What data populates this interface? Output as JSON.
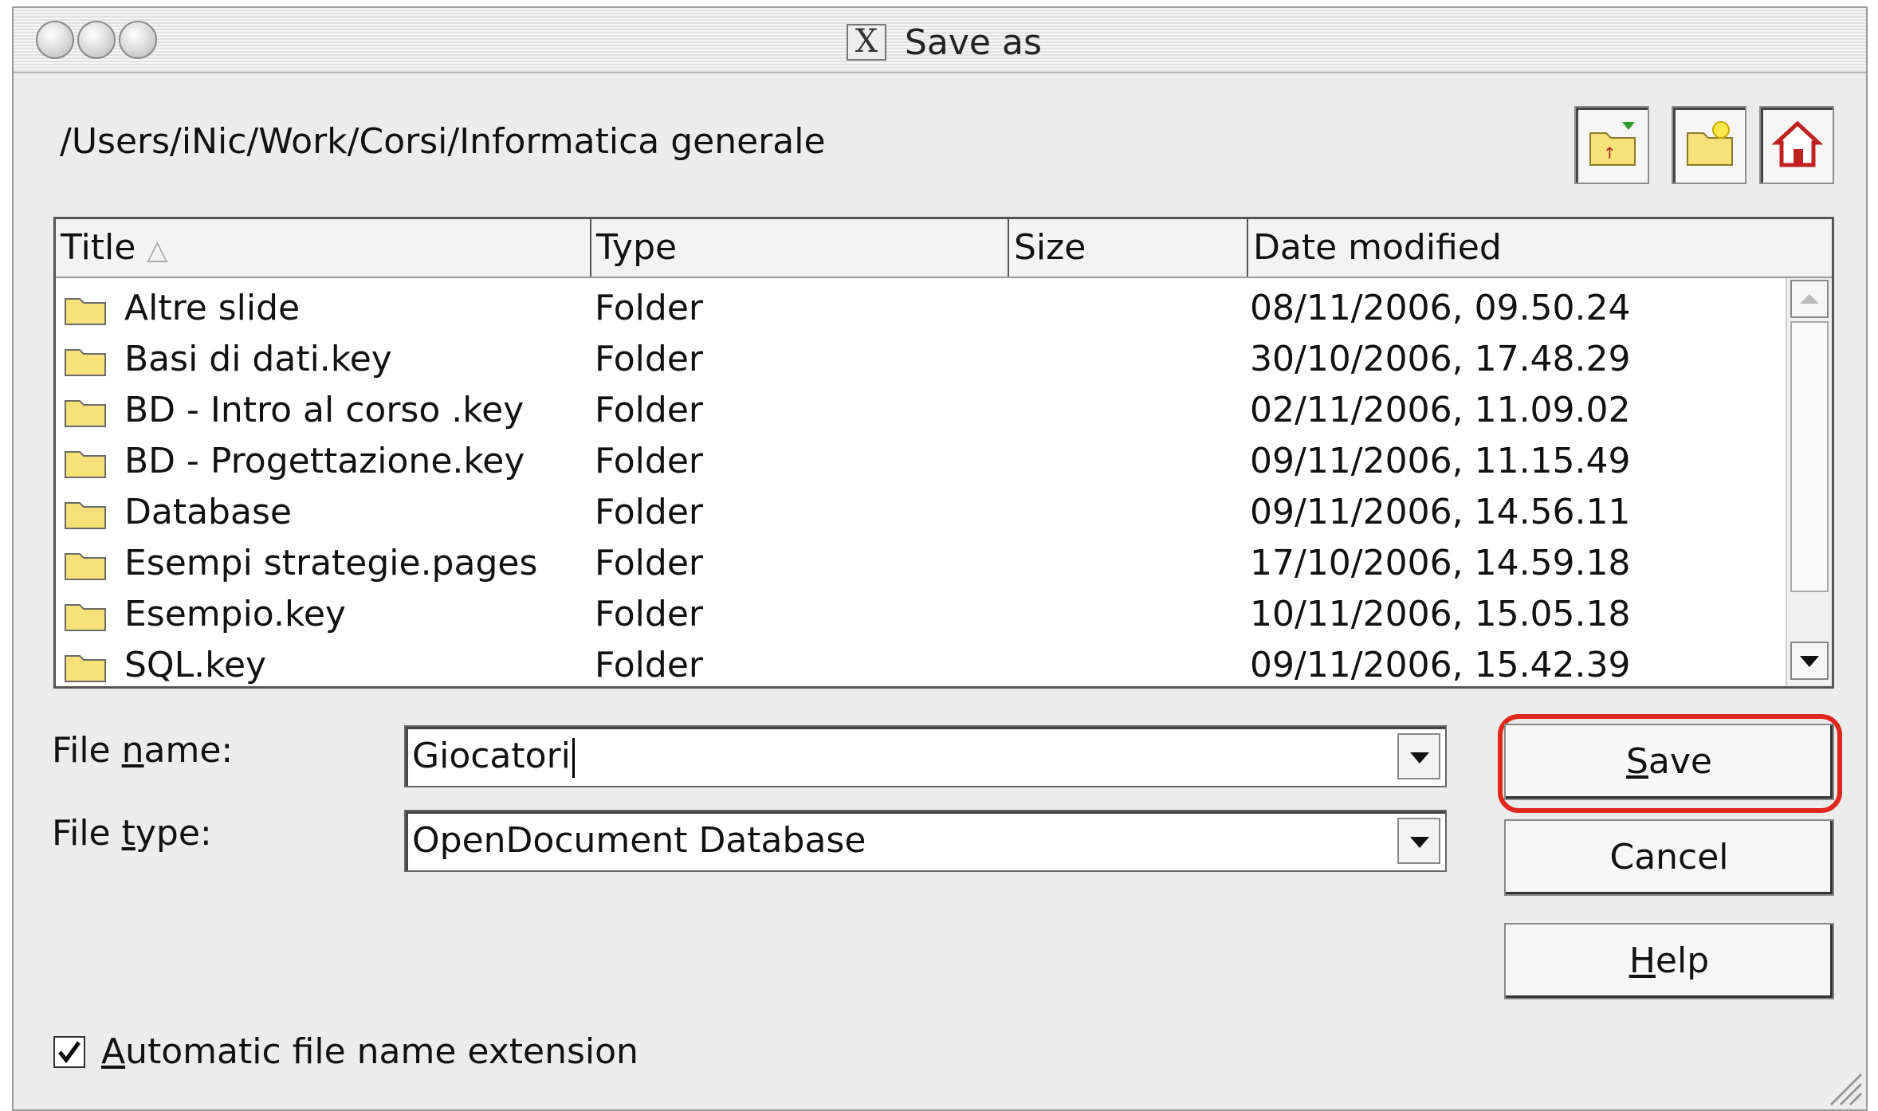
{
  "window": {
    "title": "Save as"
  },
  "path": "/Users/iNic/Work/Corsi/Informatica generale",
  "toolbar": {
    "up_icon": "folder-up-icon",
    "new_folder_icon": "new-folder-icon",
    "home_icon": "home-icon"
  },
  "columns": [
    "Title",
    "Type",
    "Size",
    "Date modified"
  ],
  "files": [
    {
      "name": "Altre slide",
      "type": "Folder",
      "size": "",
      "date": "08/11/2006, 09.50.24"
    },
    {
      "name": "Basi di dati.key",
      "type": "Folder",
      "size": "",
      "date": "30/10/2006, 17.48.29"
    },
    {
      "name": "BD - Intro al corso .key",
      "type": "Folder",
      "size": "",
      "date": "02/11/2006, 11.09.02"
    },
    {
      "name": "BD - Progettazione.key",
      "type": "Folder",
      "size": "",
      "date": "09/11/2006, 11.15.49"
    },
    {
      "name": "Database",
      "type": "Folder",
      "size": "",
      "date": "09/11/2006, 14.56.11"
    },
    {
      "name": "Esempi strategie.pages",
      "type": "Folder",
      "size": "",
      "date": "17/10/2006, 14.59.18"
    },
    {
      "name": "Esempio.key",
      "type": "Folder",
      "size": "",
      "date": "10/11/2006, 15.05.18"
    },
    {
      "name": "SQL.key",
      "type": "Folder",
      "size": "",
      "date": "09/11/2006, 15.42.39"
    }
  ],
  "form": {
    "file_name_label_pre": "File ",
    "file_name_label_u": "n",
    "file_name_label_post": "ame:",
    "file_name_value": "Giocatori",
    "file_type_label_pre": "File ",
    "file_type_label_u": "t",
    "file_type_label_post": "ype:",
    "file_type_value": "OpenDocument Database"
  },
  "buttons": {
    "save_u": "S",
    "save_rest": "ave",
    "cancel": "Cancel",
    "help_u": "H",
    "help_rest": "elp"
  },
  "options": {
    "auto_ext_u": "A",
    "auto_ext_rest": "utomatic file name extension",
    "auto_ext_checked": true
  },
  "colors": {
    "highlight": "#e1261c",
    "folder": "#f7e27a"
  }
}
